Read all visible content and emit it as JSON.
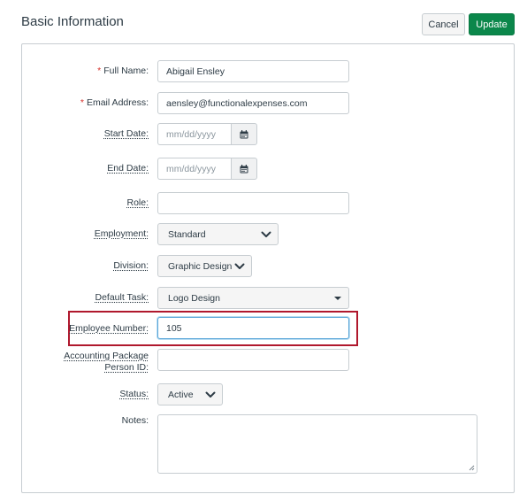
{
  "header": {
    "title": "Basic Information",
    "cancel_label": "Cancel",
    "update_label": "Update"
  },
  "form": {
    "full_name": {
      "label": "Full Name:",
      "required_mark": "*",
      "value": "Abigail Ensley"
    },
    "email": {
      "label": "Email Address:",
      "required_mark": "*",
      "value": "aensley@functionalexpenses.com"
    },
    "start_date": {
      "label": "Start Date:",
      "placeholder": "mm/dd/yyyy",
      "icon": "calendar-icon"
    },
    "end_date": {
      "label": "End Date:",
      "placeholder": "mm/dd/yyyy",
      "icon": "calendar-icon"
    },
    "role": {
      "label": "Role:",
      "value": ""
    },
    "employment": {
      "label": "Employment:",
      "value": "Standard"
    },
    "division": {
      "label": "Division:",
      "value": "Graphic Design"
    },
    "default_task": {
      "label": "Default Task:",
      "value": "Logo Design"
    },
    "employee_number": {
      "label": "Employee Number:",
      "value": "105"
    },
    "accounting_id": {
      "label_line1": "Accounting Package",
      "label_line2": "Person ID:",
      "value": ""
    },
    "status": {
      "label": "Status:",
      "value": "Active"
    },
    "notes": {
      "label": "Notes:",
      "value": ""
    }
  },
  "colors": {
    "update_button": "#0b874b",
    "required_asterisk": "#d6332d",
    "highlight_box": "#b0182d",
    "focus_border": "#5aa6d8"
  }
}
